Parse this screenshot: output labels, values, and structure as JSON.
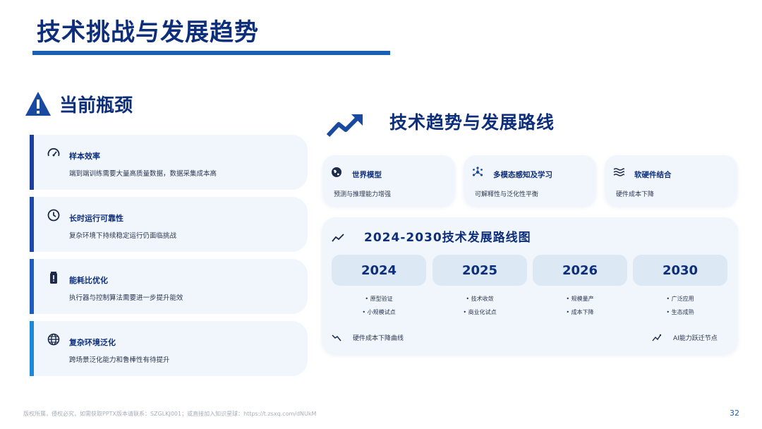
{
  "page_title": "技术挑战与发展趋势",
  "bottleneck": {
    "heading": "当前瓶颈",
    "items": [
      {
        "icon": "gauge-icon",
        "title": "样本效率",
        "desc": "端到端训练需要大量高质量数据，数据采集成本高"
      },
      {
        "icon": "clock-icon",
        "title": "长时运行可靠性",
        "desc": "复杂环境下持续稳定运行仍面临挑战"
      },
      {
        "icon": "battery-icon",
        "title": "能耗比优化",
        "desc": "执行器与控制算法需要进一步提升能效"
      },
      {
        "icon": "globe-icon",
        "title": "复杂环境泛化",
        "desc": "跨场景泛化能力和鲁棒性有待提升"
      }
    ]
  },
  "trends": {
    "heading": "技术趋势与发展路线",
    "tiles": [
      {
        "icon": "globe-icon",
        "title": "世界模型",
        "desc": "预测与推理能力增强"
      },
      {
        "icon": "network-icon",
        "title": "多模态感知及学习",
        "desc": "可解释性与泛化性平衡"
      },
      {
        "icon": "waves-icon",
        "title": "软硬件结合",
        "desc": "硬件成本下降"
      }
    ],
    "roadmap": {
      "title": "2024-2030技术发展路线图",
      "years": [
        {
          "year": "2024",
          "points": [
            "原型验证",
            "小规模试点"
          ]
        },
        {
          "year": "2025",
          "points": [
            "技术收敛",
            "商业化试点"
          ]
        },
        {
          "year": "2026",
          "points": [
            "规模量产",
            "成本下降"
          ]
        },
        {
          "year": "2030",
          "points": [
            "广泛应用",
            "生态成熟"
          ]
        }
      ],
      "footer_left": "硬件成本下降曲线",
      "footer_right": "AI能力跃迁节点"
    }
  },
  "footer": {
    "copyright": "版权所属，侵权必究，如需获取PPTX版本请联系：SZGLKJ001；或直接加入知识星球：https://t.zsxq.com/dNUkM",
    "page_number": "32"
  },
  "colors": {
    "primary": "#0d2e7a",
    "accent": "#1a5fb4",
    "card_bg": "#f1f6fc"
  }
}
